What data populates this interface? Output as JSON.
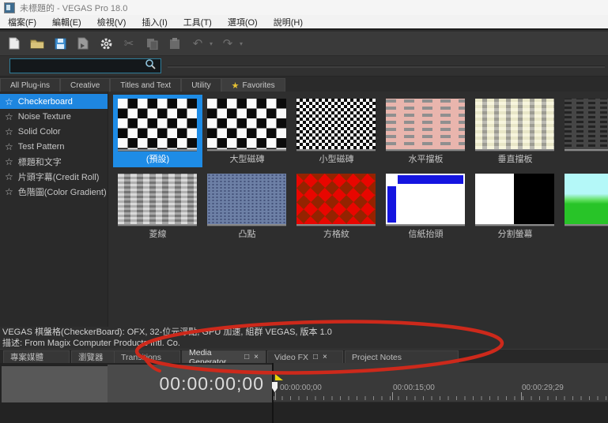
{
  "window": {
    "title": "未標題的 - VEGAS Pro 18.0"
  },
  "menu": {
    "items": [
      "檔案(F)",
      "編輯(E)",
      "檢視(V)",
      "插入(I)",
      "工具(T)",
      "選項(O)",
      "說明(H)"
    ]
  },
  "toolbar": {
    "icons": [
      "new-project",
      "open-project",
      "save-project",
      "render-as",
      "project-properties",
      "cut",
      "copy",
      "paste",
      "undo",
      "redo"
    ],
    "cut_glyph": "✂",
    "undo_glyph": "↶",
    "redo_glyph": "↷",
    "caret_glyph": "▾"
  },
  "search": {
    "value": ""
  },
  "plugin_tabs": {
    "items": [
      "All Plug-ins",
      "Creative",
      "Titles and Text",
      "Utility",
      "Favorites"
    ],
    "favorites_star": "★"
  },
  "sidebar": {
    "star_glyph": "☆",
    "items": [
      {
        "label": "Checkerboard",
        "selected": true
      },
      {
        "label": "Noise Texture",
        "selected": false
      },
      {
        "label": "Solid Color",
        "selected": false
      },
      {
        "label": "Test Pattern",
        "selected": false
      },
      {
        "label": "標題和文字",
        "selected": false
      },
      {
        "label": "片頭字幕(Credit Roll)",
        "selected": false
      },
      {
        "label": "色階圖(Color Gradient)",
        "selected": false
      }
    ]
  },
  "presets": {
    "row1": [
      "(預設)",
      "大型磁磚",
      "小型磁磚",
      "水平擋板",
      "垂直擋板",
      ""
    ],
    "row2": [
      "菱線",
      "凸點",
      "方格紋",
      "信紙抬頭",
      "分割螢幕",
      ""
    ]
  },
  "info": {
    "line1": "VEGAS 棋盤格(CheckerBoard): OFX, 32-位元浮點, GPU 加速, 組群 VEGAS, 版本 1.0",
    "line2": "描述: From Magix Computer Products Intl. Co."
  },
  "dock_tabs": {
    "restore_glyph": "□",
    "close_glyph": "×",
    "items": [
      {
        "label": "專案媒體"
      },
      {
        "label": "瀏覽器"
      },
      {
        "label": "Transitions"
      },
      {
        "label": "Media Generator",
        "active": true
      },
      {
        "label": "Video FX"
      },
      {
        "label": "Project Notes"
      }
    ]
  },
  "timeline": {
    "timecode": "00:00:00;00",
    "ruler_labels": [
      "00:00:00;00",
      "00:00:15;00",
      "00:00:29;29"
    ]
  },
  "colors": {
    "accent": "#1e8ce6",
    "annotation": "#cd291b",
    "favorites_star": "#e7c233"
  }
}
